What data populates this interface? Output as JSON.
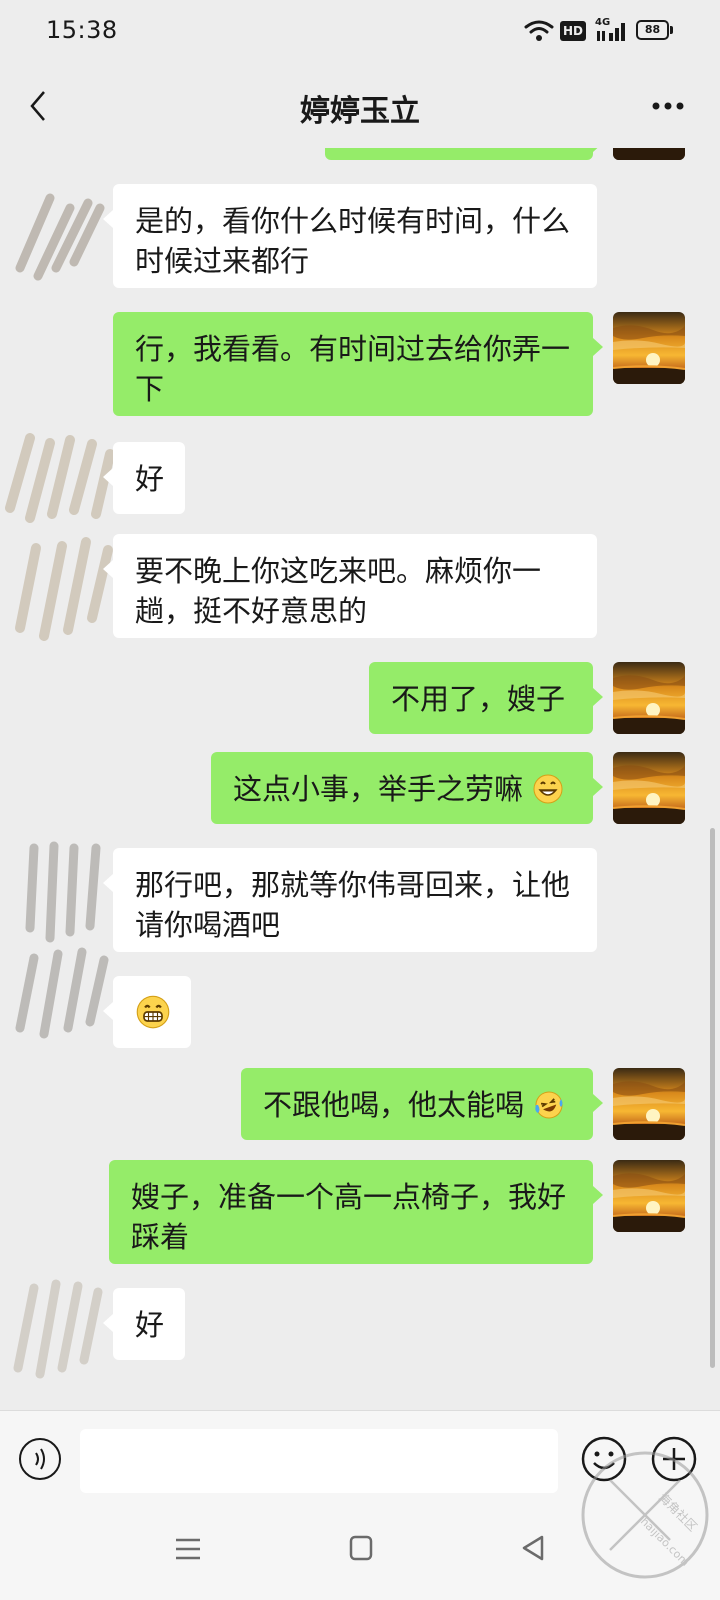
{
  "status_bar": {
    "time": "15:38",
    "hd_label": "HD",
    "network_label": "4G",
    "battery_level": "88"
  },
  "header": {
    "title": "婷婷玉立"
  },
  "messages": [
    {
      "side": "in",
      "text": "是的，看你什么时候有时间，什么时候过来都行"
    },
    {
      "side": "out",
      "text": "行，我看看。有时间过去给你弄一下"
    },
    {
      "side": "in",
      "text": "好"
    },
    {
      "side": "in",
      "text": "要不晚上你这吃来吧。麻烦你一趟，挺不好意思的"
    },
    {
      "side": "out",
      "text": "不用了，嫂子"
    },
    {
      "side": "out",
      "text": "这点小事，举手之劳嘛",
      "emoji": "grinning-face-icon"
    },
    {
      "side": "in",
      "text": "那行吧，那就等你伟哥回来，让他请你喝酒吧"
    },
    {
      "side": "in",
      "text": "",
      "emoji": "grimacing-grin-icon"
    },
    {
      "side": "out",
      "text": "不跟他喝，他太能喝",
      "emoji": "laughing-tears-icon"
    },
    {
      "side": "out",
      "text": "嫂子，准备一个高一点椅子，我好踩着"
    },
    {
      "side": "in",
      "text": "好"
    }
  ],
  "colors": {
    "background": "#ededed",
    "outgoing_bubble": "#95ec69",
    "incoming_bubble": "#ffffff"
  },
  "watermark": {
    "text_cn": "海角社区",
    "text_url": "haijiao.com"
  }
}
